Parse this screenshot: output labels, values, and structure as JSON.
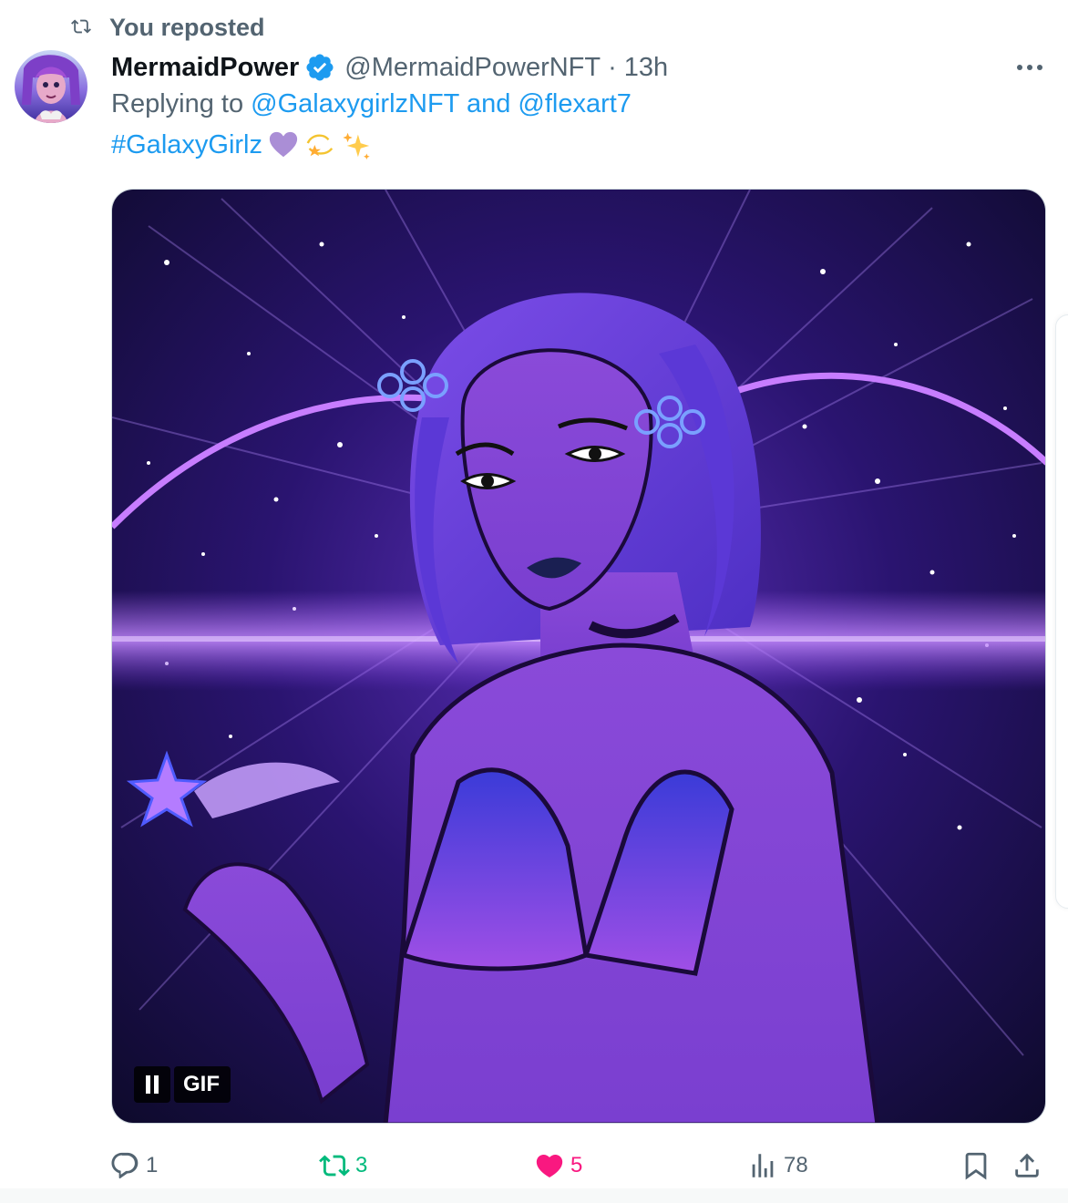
{
  "repost_banner": {
    "icon": "repost-icon",
    "text": "You reposted"
  },
  "author": {
    "display_name": "MermaidPower",
    "verified_icon": "verified-badge-icon",
    "handle": "@MermaidPowerNFT",
    "separator": "·",
    "time": "13h",
    "avatar_icon": "avatar"
  },
  "reply_context": {
    "prefix": "Replying to",
    "mention_1": "@GalaxygirlzNFT",
    "conjunction": "and",
    "mention_2": "@flexart7"
  },
  "tweet": {
    "hashtag": "#GalaxyGirlz",
    "emojis": [
      "purple-heart-emoji",
      "dizzy-star-emoji",
      "sparkles-emoji"
    ]
  },
  "media": {
    "type": "gif",
    "gif_label": "GIF",
    "pause_icon": "pause-icon",
    "description_icon": "galaxy-girl-artwork"
  },
  "actions": {
    "replies": "1",
    "reposts": "3",
    "likes": "5",
    "views": "78"
  },
  "colors": {
    "accent": "#1d9bf0",
    "repost_active": "#00ba7c",
    "like_active": "#f91880",
    "muted": "#536471"
  }
}
